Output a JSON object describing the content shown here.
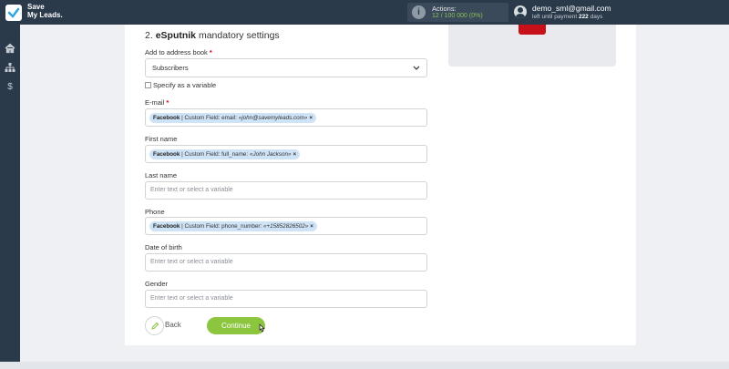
{
  "app": {
    "brand_line1": "Save",
    "brand_line2": "My Leads."
  },
  "header": {
    "actions_label": "Actions:",
    "actions_count": "12 / 100 000 (0%)",
    "user_email": "demo_sml@gmail.com",
    "plan_prefix": "left until payment",
    "plan_days": "222",
    "plan_suffix": "days"
  },
  "sidebar": {
    "items": [
      {
        "icon": "home-icon"
      },
      {
        "icon": "sitemap-icon"
      },
      {
        "icon": "dollar-icon",
        "glyph": "$"
      }
    ]
  },
  "form": {
    "section_number": "2.",
    "section_name": "eSputnik",
    "section_suffix": "mandatory settings",
    "address_book_label": "Add to address book",
    "address_book_value": "Subscribers",
    "specify_variable_label": "Specify as a variable",
    "required_mark": "*",
    "fields": {
      "email": {
        "label": "E-mail",
        "chip_source": "Facebook",
        "chip_field": " | Custom Field: email: ",
        "chip_value": "«john@savemyleads.com»",
        "chip_remove": "×"
      },
      "first_name": {
        "label": "First name",
        "chip_source": "Facebook",
        "chip_field": " | Custom Field: full_name: ",
        "chip_value": "«John Jackson»",
        "chip_remove": "×"
      },
      "last_name": {
        "label": "Last name",
        "placeholder": "Enter text or select a variable"
      },
      "phone": {
        "label": "Phone",
        "chip_source": "Facebook",
        "chip_field": " | Custom Field: phone_number: ",
        "chip_value": "«+15852826502»",
        "chip_remove": "×"
      },
      "date_of_birth": {
        "label": "Date of birth",
        "placeholder": "Enter text or select a variable"
      },
      "gender": {
        "label": "Gender",
        "placeholder": "Enter text or select a variable"
      }
    },
    "back_label": "Back",
    "continue_label": "Continue"
  },
  "colors": {
    "topbar": "#2b3a4a",
    "accent_green": "#8cc63f",
    "chip_bg": "#cfe3f6",
    "required_red": "#d0021b",
    "youtube_red": "#c8101a"
  }
}
